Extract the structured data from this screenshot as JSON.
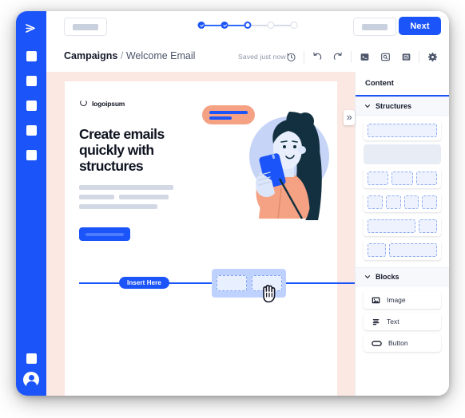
{
  "app": {
    "logo_icon": "chevron-right-logo",
    "rail_items": [
      "rail-square-1",
      "rail-square-2",
      "rail-square-3",
      "rail-square-4",
      "rail-square-5"
    ],
    "rail_bottom_items": [
      "rail-square-settings",
      "rail-avatar"
    ]
  },
  "topbar": {
    "back_button_label": "",
    "secondary_button_label": "",
    "next_label": "Next",
    "steps": [
      {
        "state": "done"
      },
      {
        "state": "done"
      },
      {
        "state": "current"
      },
      {
        "state": "todo"
      },
      {
        "state": "todo"
      }
    ]
  },
  "breadcrumb": {
    "root": "Campaigns",
    "separator": "/",
    "current": "Welcome Email"
  },
  "status": {
    "saved_text": "Saved just now",
    "history_icon": "history-clock-icon"
  },
  "tools": [
    {
      "name": "undo-icon",
      "label": "Undo"
    },
    {
      "name": "redo-icon",
      "label": "Redo"
    },
    {
      "name": "code-terminal-icon",
      "label": "Code"
    },
    {
      "name": "preview-icon",
      "label": "Preview"
    },
    {
      "name": "test-check-icon",
      "label": "Test"
    },
    {
      "name": "gear-icon",
      "label": "Settings"
    }
  ],
  "email": {
    "logo_text": "logoipsum",
    "logo_icon": "circle-arc-logo",
    "headline": "Create emails quickly with structures",
    "paragraph_placeholders": 4,
    "cta_button_label": "",
    "bubble_lines": 2,
    "insert_label": "Insert Here",
    "drag_columns": 2,
    "cursor": "grab-hand-cursor"
  },
  "panel": {
    "tab_label": "Content",
    "collapse_icon": "double-chevron-right-icon",
    "sections": [
      {
        "title": "Structures",
        "expanded": true,
        "chevron_icon": "chevron-down-icon",
        "items": [
          {
            "name": "structure-1-col",
            "columns": [
              1
            ],
            "state": "normal"
          },
          {
            "name": "structure-empty-slot",
            "columns": [],
            "state": "empty"
          },
          {
            "name": "structure-3-col",
            "columns": [
              1,
              1,
              1
            ],
            "state": "normal"
          },
          {
            "name": "structure-4-col",
            "columns": [
              1,
              1,
              1,
              1
            ],
            "state": "normal"
          },
          {
            "name": "structure-2-col-wide-left",
            "columns": [
              2.4,
              1
            ],
            "state": "normal"
          },
          {
            "name": "structure-2-col-wide-right",
            "columns": [
              1,
              2.4
            ],
            "state": "normal"
          }
        ]
      },
      {
        "title": "Blocks",
        "expanded": true,
        "chevron_icon": "chevron-down-icon",
        "items": [
          {
            "label": "Image",
            "icon": "image-icon"
          },
          {
            "label": "Text",
            "icon": "text-lines-icon"
          },
          {
            "label": "Button",
            "icon": "button-pill-icon"
          }
        ]
      }
    ]
  },
  "colors": {
    "brand_blue": "#1B54F8",
    "canvas_pink": "#FCE8E2",
    "placeholder_gray": "#D3D9E4",
    "panel_gray": "#F6F8FC",
    "illustration_skin": "#F5A183",
    "illustration_hair": "#12303F",
    "illustration_circle": "#C6D4F7"
  }
}
